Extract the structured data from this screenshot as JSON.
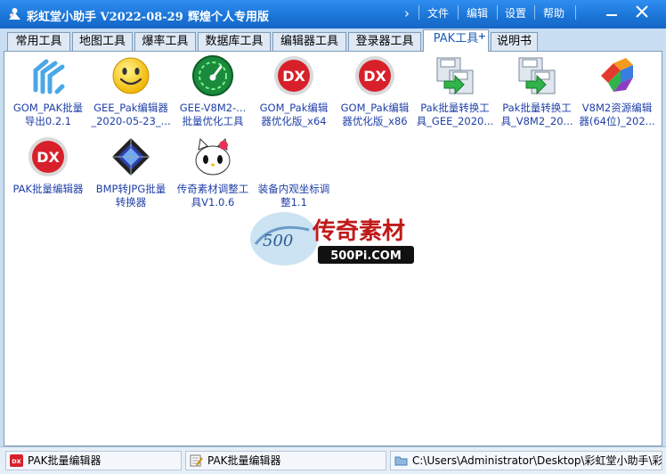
{
  "window": {
    "title": "彩虹堂小助手 V2022-08-29",
    "subtitle": "辉煌个人专用版",
    "menu": [
      "文件",
      "编辑",
      "设置",
      "帮助"
    ]
  },
  "tabs": [
    {
      "label": "常用工具"
    },
    {
      "label": "地图工具"
    },
    {
      "label": "爆率工具"
    },
    {
      "label": "数据库工具"
    },
    {
      "label": "编辑器工具"
    },
    {
      "label": "登录器工具"
    },
    {
      "label": "PAK工具",
      "active": true,
      "plus": "+"
    },
    {
      "label": "说明书"
    }
  ],
  "items": [
    {
      "label": "GOM_PAK批量\n导出0.2.1",
      "icon": "gom-stripes-icon"
    },
    {
      "label": "GEE_Pak编辑器\n_2020-05-23_...",
      "icon": "smiley-icon"
    },
    {
      "label": "GEE-V8M2-...\n批量优化工具",
      "icon": "gauge-icon"
    },
    {
      "label": "GOM_Pak编辑\n器优化版_x64",
      "icon": "dx-icon"
    },
    {
      "label": "GOM_Pak编辑\n器优化版_x86",
      "icon": "dx-icon"
    },
    {
      "label": "Pak批量转换工\n具_GEE_2020...",
      "icon": "converter-icon"
    },
    {
      "label": "Pak批量转换工\n具_V8M2_20...",
      "icon": "converter-icon"
    },
    {
      "label": "V8M2资源编辑\n器(64位)_202...",
      "icon": "cubes-icon"
    },
    {
      "label": "PAK批量编辑器",
      "icon": "dx-icon"
    },
    {
      "label": "BMP转JPG批量\n转换器",
      "icon": "diamond-icon"
    },
    {
      "label": "传奇素材调整工\n具V1.0.6",
      "icon": "kitty-icon"
    },
    {
      "label": "装备内观坐标调\n整1.1",
      "icon": "none"
    }
  ],
  "watermark": {
    "brand": "传奇素材",
    "site": "500Pi.COM",
    "badge": "500"
  },
  "status": {
    "seg1": "PAK批量编辑器",
    "seg2": "PAK批量编辑器",
    "seg3": "C:\\Users\\Administrator\\Desktop\\彩虹堂小助手\\彩"
  },
  "colors": {
    "titlebar": "#1a74d6",
    "label": "#1f3fa8",
    "active_tab": "#1f5fb8"
  }
}
